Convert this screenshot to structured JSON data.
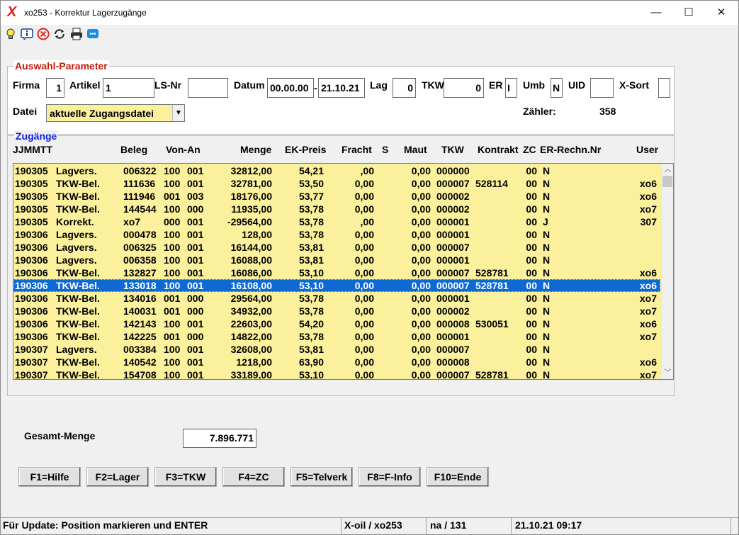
{
  "window": {
    "title": "xo253 - Korrektur Lagerzugänge",
    "minimize": "—",
    "maximize": "☐",
    "close": "✕",
    "app_icon": "X"
  },
  "toolbar": {
    "icons": [
      "bulb-icon",
      "info-icon",
      "stop-icon",
      "refresh-icon",
      "print-icon",
      "chat-icon"
    ]
  },
  "params": {
    "legend": "Auswahl-Parameter",
    "firma_label": "Firma",
    "firma_value": "1",
    "artikel_label": "Artikel",
    "artikel_value": "1",
    "lsnr_label": "LS-Nr",
    "lsnr_value": "",
    "datum_label": "Datum",
    "datum_from": "00.00.00",
    "datum_sep": "-",
    "datum_to": "21.10.21",
    "lag_label": "Lag",
    "lag_value": "0",
    "tkw_label": "TKW",
    "tkw_value": "0",
    "er_label": "ER",
    "er_value": "I",
    "umb_label": "Umb",
    "umb_value": "N",
    "uid_label": "UID",
    "uid_value": "",
    "xsort_label": "X-Sort",
    "xsort_value": "",
    "datei_label": "Datei",
    "datei_value": "aktuelle Zugangsdatei",
    "zaehler_label": "Zähler:",
    "zaehler_value": "358"
  },
  "zugaenge": {
    "legend": "Zugänge",
    "headers": {
      "datum": "JJMMTT",
      "beleg": "Beleg",
      "vonan": "Von-An",
      "menge": "Menge",
      "ekpreis": "EK-Preis",
      "fracht": "Fracht",
      "s": "S",
      "maut": "Maut",
      "tkw": "TKW",
      "kontrakt": "Kontrakt",
      "zc": "ZC",
      "er": "ER-Rechn.Nr",
      "user": "User"
    },
    "rows": [
      {
        "date": "190305",
        "type": "Lagvers.",
        "beleg": "006322",
        "von": "100",
        "an": "001",
        "menge": "32812,00",
        "ek": "54,21",
        "fracht": ",00",
        "maut": "0,00",
        "tkw": "000000",
        "kontrakt": "",
        "zc": "00",
        "er": "N",
        "user": ""
      },
      {
        "date": "190305",
        "type": "TKW-Bel.",
        "beleg": "111636",
        "von": "100",
        "an": "001",
        "menge": "32781,00",
        "ek": "53,50",
        "fracht": "0,00",
        "maut": "0,00",
        "tkw": "000007",
        "kontrakt": "528114",
        "zc": "00",
        "er": "N",
        "user": "xo6"
      },
      {
        "date": "190305",
        "type": "TKW-Bel.",
        "beleg": "111946",
        "von": "001",
        "an": "003",
        "menge": "18176,00",
        "ek": "53,77",
        "fracht": "0,00",
        "maut": "0,00",
        "tkw": "000002",
        "kontrakt": "",
        "zc": "00",
        "er": "N",
        "user": "xo6"
      },
      {
        "date": "190305",
        "type": "TKW-Bel.",
        "beleg": "144544",
        "von": "100",
        "an": "000",
        "menge": "11935,00",
        "ek": "53,78",
        "fracht": "0,00",
        "maut": "0,00",
        "tkw": "000002",
        "kontrakt": "",
        "zc": "00",
        "er": "N",
        "user": "xo7"
      },
      {
        "date": "190305",
        "type": "Korrekt.",
        "beleg": "xo7",
        "von": "000",
        "an": "001",
        "menge": "-29564,00",
        "ek": "53,78",
        "fracht": ",00",
        "maut": "0,00",
        "tkw": "000001",
        "kontrakt": "",
        "zc": "00",
        "er": "J",
        "user": "307"
      },
      {
        "date": "190306",
        "type": "Lagvers.",
        "beleg": "000478",
        "von": "100",
        "an": "001",
        "menge": "128,00",
        "ek": "53,78",
        "fracht": "0,00",
        "maut": "0,00",
        "tkw": "000001",
        "kontrakt": "",
        "zc": "00",
        "er": "N",
        "user": ""
      },
      {
        "date": "190306",
        "type": "Lagvers.",
        "beleg": "006325",
        "von": "100",
        "an": "001",
        "menge": "16144,00",
        "ek": "53,81",
        "fracht": "0,00",
        "maut": "0,00",
        "tkw": "000007",
        "kontrakt": "",
        "zc": "00",
        "er": "N",
        "user": ""
      },
      {
        "date": "190306",
        "type": "Lagvers.",
        "beleg": "006358",
        "von": "100",
        "an": "001",
        "menge": "16088,00",
        "ek": "53,81",
        "fracht": "0,00",
        "maut": "0,00",
        "tkw": "000001",
        "kontrakt": "",
        "zc": "00",
        "er": "N",
        "user": ""
      },
      {
        "date": "190306",
        "type": "TKW-Bel.",
        "beleg": "132827",
        "von": "100",
        "an": "001",
        "menge": "16086,00",
        "ek": "53,10",
        "fracht": "0,00",
        "maut": "0,00",
        "tkw": "000007",
        "kontrakt": "528781",
        "zc": "00",
        "er": "N",
        "user": "xo6"
      },
      {
        "date": "190306",
        "type": "TKW-Bel.",
        "beleg": "133018",
        "von": "100",
        "an": "001",
        "menge": "16108,00",
        "ek": "53,10",
        "fracht": "0,00",
        "maut": "0,00",
        "tkw": "000007",
        "kontrakt": "528781",
        "zc": "00",
        "er": "N",
        "user": "xo6",
        "selected": true
      },
      {
        "date": "190306",
        "type": "TKW-Bel.",
        "beleg": "134016",
        "von": "001",
        "an": "000",
        "menge": "29564,00",
        "ek": "53,78",
        "fracht": "0,00",
        "maut": "0,00",
        "tkw": "000001",
        "kontrakt": "",
        "zc": "00",
        "er": "N",
        "user": "xo7"
      },
      {
        "date": "190306",
        "type": "TKW-Bel.",
        "beleg": "140031",
        "von": "001",
        "an": "000",
        "menge": "34932,00",
        "ek": "53,78",
        "fracht": "0,00",
        "maut": "0,00",
        "tkw": "000002",
        "kontrakt": "",
        "zc": "00",
        "er": "N",
        "user": "xo7"
      },
      {
        "date": "190306",
        "type": "TKW-Bel.",
        "beleg": "142143",
        "von": "100",
        "an": "001",
        "menge": "22603,00",
        "ek": "54,20",
        "fracht": "0,00",
        "maut": "0,00",
        "tkw": "000008",
        "kontrakt": "530051",
        "zc": "00",
        "er": "N",
        "user": "xo6"
      },
      {
        "date": "190306",
        "type": "TKW-Bel.",
        "beleg": "142225",
        "von": "001",
        "an": "000",
        "menge": "14822,00",
        "ek": "53,78",
        "fracht": "0,00",
        "maut": "0,00",
        "tkw": "000001",
        "kontrakt": "",
        "zc": "00",
        "er": "N",
        "user": "xo7"
      },
      {
        "date": "190307",
        "type": "Lagvers.",
        "beleg": "003384",
        "von": "100",
        "an": "001",
        "menge": "32608,00",
        "ek": "53,81",
        "fracht": "0,00",
        "maut": "0,00",
        "tkw": "000007",
        "kontrakt": "",
        "zc": "00",
        "er": "N",
        "user": ""
      },
      {
        "date": "190307",
        "type": "TKW-Bel.",
        "beleg": "140542",
        "von": "100",
        "an": "001",
        "menge": "1218,00",
        "ek": "63,90",
        "fracht": "0,00",
        "maut": "0,00",
        "tkw": "000008",
        "kontrakt": "",
        "zc": "00",
        "er": "N",
        "user": "xo6"
      },
      {
        "date": "190307",
        "type": "TKW-Bel.",
        "beleg": "154708",
        "von": "100",
        "an": "001",
        "menge": "33189,00",
        "ek": "53,10",
        "fracht": "0,00",
        "maut": "0,00",
        "tkw": "000007",
        "kontrakt": "528781",
        "zc": "00",
        "er": "N",
        "user": "xo7"
      }
    ]
  },
  "total": {
    "label": "Gesamt-Menge",
    "value": "7.896.771"
  },
  "buttons": {
    "f1": "F1=Hilfe",
    "f2": "F2=Lager",
    "f3": "F3=TKW",
    "f4": "F4=ZC",
    "f5": "F5=Telverk",
    "f8": "F8=F-Info",
    "f10": "F10=Ende"
  },
  "statusbar": {
    "hint": "Für Update: Position markieren und ENTER",
    "app": "X-oil / xo253",
    "user": "na / 131",
    "datetime": "21.10.21 09:17"
  },
  "colors": {
    "list_bg": "#fbf19c",
    "selection": "#0f69d2",
    "legend_params": "#c41e0c",
    "legend_zugaenge": "#1020e0"
  }
}
